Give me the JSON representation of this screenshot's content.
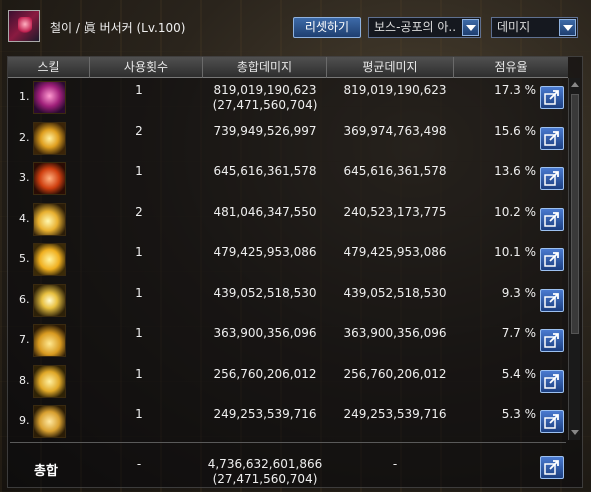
{
  "character": {
    "name": "철이 / 眞 버서커 (Lv.100)"
  },
  "toolbar": {
    "reset_label": "리셋하기",
    "boss_select": "보스-공포의 아..",
    "metric_select": "데미지"
  },
  "table": {
    "headers": [
      "스킬",
      "사용횟수",
      "총합데미지",
      "평균데미지",
      "점유율"
    ],
    "rows": [
      {
        "rank": "1.",
        "icon": "berserker-skill-icon-1",
        "uses": "1",
        "total": "819,019,190,623",
        "total_sub": "(27,471,560,704)",
        "average": "819,019,190,623",
        "share": "17.3 %"
      },
      {
        "rank": "2.",
        "icon": "berserker-skill-icon-2",
        "uses": "2",
        "total": "739,949,526,997",
        "total_sub": "",
        "average": "369,974,763,498",
        "share": "15.6 %"
      },
      {
        "rank": "3.",
        "icon": "berserker-skill-icon-3",
        "uses": "1",
        "total": "645,616,361,578",
        "total_sub": "",
        "average": "645,616,361,578",
        "share": "13.6 %"
      },
      {
        "rank": "4.",
        "icon": "berserker-skill-icon-4",
        "uses": "2",
        "total": "481,046,347,550",
        "total_sub": "",
        "average": "240,523,173,775",
        "share": "10.2 %"
      },
      {
        "rank": "5.",
        "icon": "berserker-skill-icon-5",
        "uses": "1",
        "total": "479,425,953,086",
        "total_sub": "",
        "average": "479,425,953,086",
        "share": "10.1 %"
      },
      {
        "rank": "6.",
        "icon": "berserker-skill-icon-6",
        "uses": "1",
        "total": "439,052,518,530",
        "total_sub": "",
        "average": "439,052,518,530",
        "share": "9.3 %"
      },
      {
        "rank": "7.",
        "icon": "berserker-skill-icon-7",
        "uses": "1",
        "total": "363,900,356,096",
        "total_sub": "",
        "average": "363,900,356,096",
        "share": "7.7 %"
      },
      {
        "rank": "8.",
        "icon": "berserker-skill-icon-8",
        "uses": "1",
        "total": "256,760,206,012",
        "total_sub": "",
        "average": "256,760,206,012",
        "share": "5.4 %"
      },
      {
        "rank": "9.",
        "icon": "berserker-skill-icon-9",
        "uses": "1",
        "total": "249,253,539,716",
        "total_sub": "",
        "average": "249,253,539,716",
        "share": "5.3 %"
      }
    ],
    "summary": {
      "label": "총합",
      "uses": "-",
      "total": "4,736,632,601,866",
      "total_sub": "(27,471,560,704)",
      "average": "-"
    }
  },
  "icons": {
    "share": "share-export-icon",
    "dropdown": "chevron-down-icon"
  },
  "colors": {
    "button_blue": "#2a5090",
    "row_text": "#efefef"
  }
}
